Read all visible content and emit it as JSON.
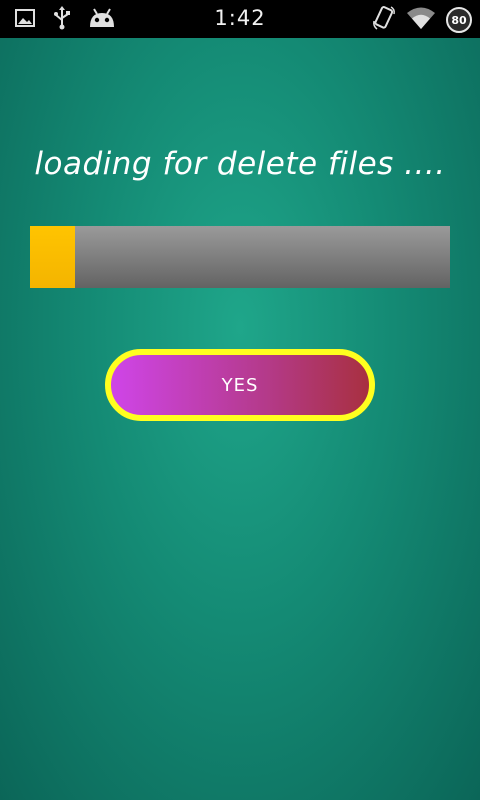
{
  "status_bar": {
    "time": "1:42",
    "battery_level": "80",
    "icons": [
      "image-icon",
      "usb-icon",
      "android-bot-icon",
      "rotate-phone-icon",
      "wifi-icon"
    ]
  },
  "main": {
    "title": "loading for delete files ....",
    "progress_fraction": 0.107,
    "colors": {
      "background": "#148a74",
      "progress_fill": "#ffc400",
      "progress_track": "#7c7c7c",
      "button_border": "#ffff1f",
      "button_left": "#cf45e8",
      "button_right": "#a83040"
    },
    "button_label": "YES"
  }
}
